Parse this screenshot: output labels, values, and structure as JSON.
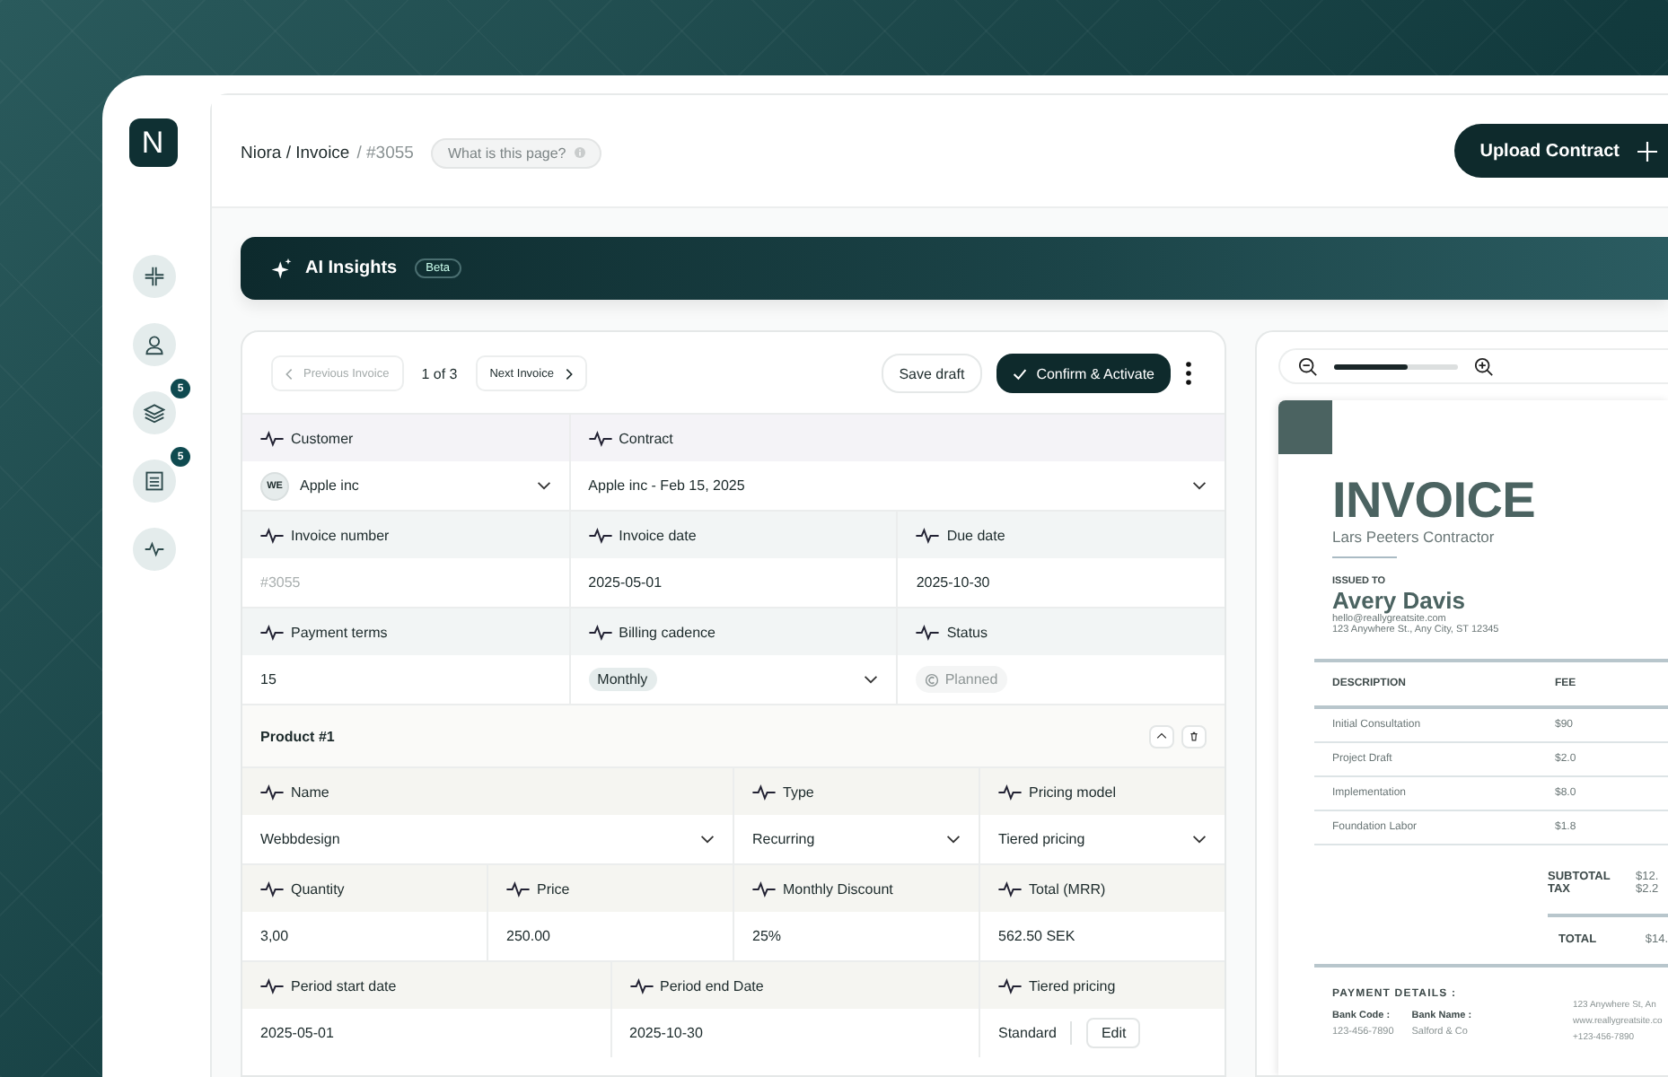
{
  "sidebar": {
    "logo": "N",
    "items": [
      {
        "kind": "collapse"
      },
      {
        "kind": "user"
      },
      {
        "kind": "layers",
        "badge": "5"
      },
      {
        "kind": "document",
        "badge": "5"
      },
      {
        "kind": "activity"
      }
    ]
  },
  "header": {
    "breadcrumb": "Niora / Invoice",
    "current": "/ #3055",
    "help": "What is this page?",
    "upload": "Upload Contract"
  },
  "ai_bar": {
    "title": "AI Insights",
    "badge": "Beta"
  },
  "toolbar": {
    "previous": "Previous Invoice",
    "previous_disabled": true,
    "count": "1 of 3",
    "next": "Next Invoice",
    "save": "Save draft",
    "confirm": "Confirm & Activate"
  },
  "fields": {
    "rows": [
      {
        "cells": [
          {
            "kind": "avatar_select",
            "label": "Customer",
            "initials": "WE",
            "value": "Apple inc"
          },
          {
            "kind": "select",
            "label": "Contract",
            "value": "Apple inc - Feb 15, 2025"
          }
        ]
      },
      {
        "cells": [
          {
            "kind": "input",
            "label": "Invoice number",
            "placeholder": "#3055"
          },
          {
            "kind": "text",
            "label": "Invoice date",
            "value": "2025-05-01"
          },
          {
            "kind": "text",
            "label": "Due date",
            "value": "2025-10-30"
          }
        ]
      },
      {
        "cells": [
          {
            "kind": "text",
            "label": "Payment terms",
            "value": "15"
          },
          {
            "kind": "chip_select",
            "label": "Billing cadence",
            "value": "Monthly"
          },
          {
            "kind": "status",
            "label": "Status",
            "value": "Planned",
            "disabled": true
          }
        ]
      }
    ]
  },
  "products": [
    {
      "title": "Product #1",
      "rows": [
        {
          "cells": [
            {
              "kind": "select",
              "label": "Name",
              "value": "Webbdesign"
            },
            {
              "kind": "select",
              "label": "Type",
              "value": "Recurring"
            },
            {
              "kind": "select",
              "label": "Pricing model",
              "value": "Tiered pricing"
            }
          ]
        },
        {
          "cells": [
            {
              "kind": "text",
              "label": "Quantity",
              "value": "3,00"
            },
            {
              "kind": "text",
              "label": "Price",
              "value": "250.00"
            },
            {
              "kind": "text",
              "label": "Monthly Discount",
              "value": "25%"
            },
            {
              "kind": "text",
              "label": "Total (MRR)",
              "value": "562.50 SEK"
            }
          ]
        },
        {
          "cells": [
            {
              "kind": "text",
              "label": "Period start date",
              "value": "2025-05-01"
            },
            {
              "kind": "text",
              "label": "Period end Date",
              "value": "2025-10-30"
            },
            {
              "kind": "edit",
              "label": "Tiered pricing",
              "value": "Standard",
              "button": "Edit"
            }
          ]
        }
      ]
    }
  ],
  "preview": {
    "zoom": {
      "level": 0.6
    },
    "document": {
      "title": "INVOICE",
      "subtitle": "Lars Peeters Contractor",
      "issued_label": "ISSUED TO",
      "name": "Avery Davis",
      "email": "hello@reallygreatsite.com",
      "address": "123 Anywhere St., Any City, ST 12345",
      "columns": [
        "DESCRIPTION",
        "FEE"
      ],
      "items": [
        {
          "description": "Initial Consultation",
          "fee": "$90"
        },
        {
          "description": "Project Draft",
          "fee": "$2.0"
        },
        {
          "description": "Implementation",
          "fee": "$8.0"
        },
        {
          "description": "Foundation Labor",
          "fee": "$1.8"
        }
      ],
      "totals": [
        {
          "label": "SUBTOTAL",
          "value": "$12."
        },
        {
          "label": "TAX",
          "value": "$2.2"
        }
      ],
      "total": {
        "label": "TOTAL",
        "value": "$14."
      },
      "payment": {
        "title": "PAYMENT DETAILS :",
        "fields": [
          {
            "label": "Bank Code :",
            "value": "123-456-7890"
          },
          {
            "label": "Bank Name :",
            "value": "Salford & Co"
          }
        ],
        "contact": [
          "123 Anywhere St, An",
          "www.reallygreatsite.co",
          "+123-456-7890"
        ]
      }
    }
  }
}
